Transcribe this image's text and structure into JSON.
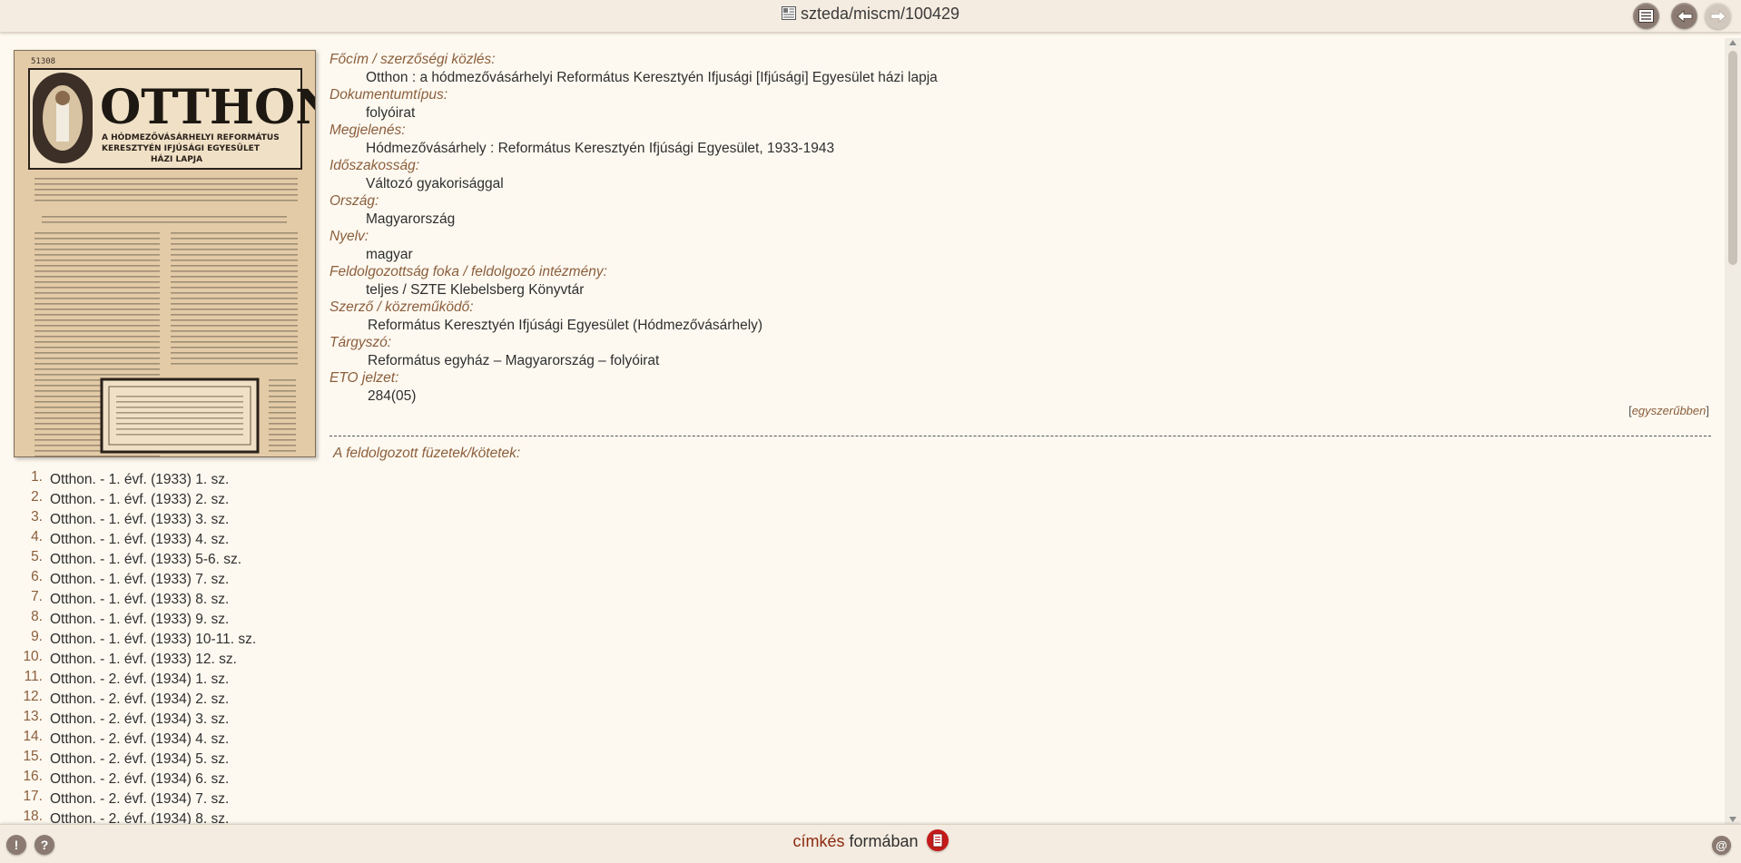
{
  "header": {
    "title": "szteda/miscm/100429",
    "doc_icon": "document-icon",
    "buttons": [
      {
        "name": "list-view-button",
        "icon": "list-icon"
      },
      {
        "name": "back-button",
        "icon": "arrow-left-icon"
      },
      {
        "name": "forward-button",
        "icon": "arrow-right-icon"
      }
    ]
  },
  "thumbnail": {
    "masthead": "OTTHON",
    "subtitle_lines": [
      "A HÓDMEZŐVÁSÁRHELYI REFORMÁTUS",
      "KERESZTYÉN IFJÚSÁGI EGYESÜLET",
      "HÁZI LAPJA"
    ],
    "stamp": "51308"
  },
  "record": {
    "fields": [
      {
        "label": "Főcím / szerzőségi közlés:",
        "value": "Otthon : a hódmezővásárhelyi Református Keresztyén Ifjusági [Ifjúsági] Egyesület házi lapja"
      },
      {
        "label": "Dokumentumtípus:",
        "value": "folyóirat"
      },
      {
        "label": "Megjelenés:",
        "value": "Hódmezővásárhely : Református Keresztyén Ifjúsági Egyesület, 1933-1943"
      },
      {
        "label": "Időszakosság:",
        "value": "Változó gyakorisággal"
      },
      {
        "label": "Ország:",
        "value": "Magyarország"
      },
      {
        "label": "Nyelv:",
        "value": "magyar"
      },
      {
        "label": "Feldolgozottság foka / feldolgozó intézmény:",
        "value": "teljes / SZTE Klebelsberg Könyvtár"
      },
      {
        "label": "Szerző / közreműködő:",
        "value": "Református Keresztyén Ifjúsági Egyesület (Hódmezővásárhely)"
      },
      {
        "label": "Tárgyszó:",
        "value": "Református egyház – Magyarország – folyóirat"
      },
      {
        "label": "ETO jelzet:",
        "value": "284(05)"
      }
    ],
    "simpler_open": "[",
    "simpler_link": "egyszerűbben",
    "simpler_close": "]"
  },
  "volumes": {
    "label": "A feldolgozott füzetek/kötetek:",
    "issues": [
      {
        "num": "1.",
        "text": "Otthon. - 1. évf. (1933) 1. sz."
      },
      {
        "num": "2.",
        "text": "Otthon. - 1. évf. (1933) 2. sz."
      },
      {
        "num": "3.",
        "text": "Otthon. - 1. évf. (1933) 3. sz."
      },
      {
        "num": "4.",
        "text": "Otthon. - 1. évf. (1933) 4. sz."
      },
      {
        "num": "5.",
        "text": "Otthon. - 1. évf. (1933) 5-6. sz."
      },
      {
        "num": "6.",
        "text": "Otthon. - 1. évf. (1933) 7. sz."
      },
      {
        "num": "7.",
        "text": "Otthon. - 1. évf. (1933) 8. sz."
      },
      {
        "num": "8.",
        "text": "Otthon. - 1. évf. (1933) 9. sz."
      },
      {
        "num": "9.",
        "text": "Otthon. - 1. évf. (1933) 10-11. sz."
      },
      {
        "num": "10.",
        "text": "Otthon. - 1. évf. (1933) 12. sz."
      },
      {
        "num": "11.",
        "text": "Otthon. - 2. évf. (1934) 1. sz."
      },
      {
        "num": "12.",
        "text": "Otthon. - 2. évf. (1934) 2. sz."
      },
      {
        "num": "13.",
        "text": "Otthon. - 2. évf. (1934) 3. sz."
      },
      {
        "num": "14.",
        "text": "Otthon. - 2. évf. (1934) 4. sz."
      },
      {
        "num": "15.",
        "text": "Otthon. - 2. évf. (1934) 5. sz."
      },
      {
        "num": "16.",
        "text": "Otthon. - 2. évf. (1934) 6. sz."
      },
      {
        "num": "17.",
        "text": "Otthon. - 2. évf. (1934) 7. sz."
      },
      {
        "num": "18.",
        "text": "Otthon. - 2. évf. (1934) 8. sz."
      }
    ]
  },
  "footer": {
    "format_label": "címkés",
    "format_suffix": "formában",
    "format_icon": "pdf-document-icon",
    "left_buttons": [
      {
        "name": "alert-button",
        "glyph": "!"
      },
      {
        "name": "help-button",
        "glyph": "?"
      }
    ],
    "right_button": {
      "name": "email-button",
      "glyph": "@"
    }
  },
  "colors": {
    "label": "#8b5e3c",
    "background": "#fdf9f0",
    "bar": "#f4ece0",
    "button": "#8a7a72"
  }
}
